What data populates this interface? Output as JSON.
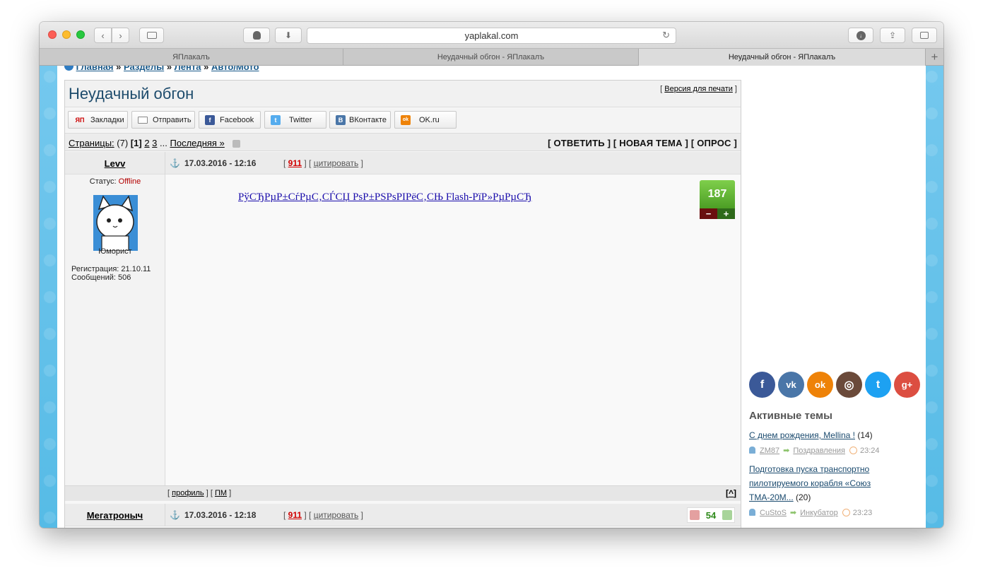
{
  "browser": {
    "url": "yaplakal.com",
    "tabs": [
      {
        "title": "ЯПлакалъ"
      },
      {
        "title": "Неудачный обгон - ЯПлакалъ"
      },
      {
        "title": "Неудачный обгон - ЯПлакалъ"
      }
    ],
    "new_tab": "+"
  },
  "breadcrumb": {
    "items": [
      "Главная",
      "Разделы",
      "Лента",
      "Авто/Мото"
    ],
    "sep": "»"
  },
  "topic": {
    "title": "Неудачный обгон",
    "print_link": "Версия для печати"
  },
  "share": [
    {
      "label": "Закладки",
      "icon": "ЯП",
      "color": "#cc0000"
    },
    {
      "label": "Отправить",
      "icon": "envelope-icon",
      "color": "#888888"
    },
    {
      "label": "Facebook",
      "icon": "f",
      "color": "#3b5998"
    },
    {
      "label": "Twitter",
      "icon": "t",
      "color": "#55acee"
    },
    {
      "label": "ВКонтакте",
      "icon": "В",
      "color": "#4a76a8"
    },
    {
      "label": "OK.ru",
      "icon": "ok",
      "color": "#ee8208"
    }
  ],
  "pages": {
    "label": "Страницы:",
    "count": "(7)",
    "current": "[1]",
    "p2": "2",
    "p3": "3",
    "ellipsis": "...",
    "last": "Последняя »"
  },
  "actions": {
    "reply": "ОТВЕТИТЬ",
    "new_topic": "НОВАЯ ТЕМА",
    "poll": "ОПРОС"
  },
  "posts": [
    {
      "author": "Levv",
      "datetime": "17.03.2016 - 12:16",
      "num": "911",
      "quote": "цитировать",
      "status_label": "Статус:",
      "status": "Offline",
      "rank": "Юморист",
      "reg": "Регистрация: 21.10.11",
      "msgs": "Сообщений: 506",
      "text": "РўСЂРµР±СѓРµС‚СЃСЏ РѕР±РЅРѕРІРёС‚СЊ Flash-РїР»РµРµСЂ",
      "rating": "187",
      "minus": "−",
      "plus": "+",
      "profile": "профиль",
      "pm": "ПМ",
      "top": "^"
    },
    {
      "author": "Мегатроныч",
      "datetime": "17.03.2016 - 12:18",
      "num": "911",
      "quote": "цитировать",
      "rating": "54"
    }
  ],
  "sidebar": {
    "social": [
      {
        "name": "facebook-icon",
        "glyph": "f",
        "color": "#3b5998"
      },
      {
        "name": "vk-icon",
        "glyph": "vk",
        "color": "#4a76a8"
      },
      {
        "name": "ok-icon",
        "glyph": "ok",
        "color": "#ee8208"
      },
      {
        "name": "instagram-icon",
        "glyph": "◎",
        "color": "#6b4a3a"
      },
      {
        "name": "twitter-icon",
        "glyph": "t",
        "color": "#1da1f2"
      },
      {
        "name": "googleplus-icon",
        "glyph": "g+",
        "color": "#dc4e41"
      }
    ],
    "active_heading": "Активные темы",
    "topics": [
      {
        "title": "С днем рождения, Mellina !",
        "count": "(14)",
        "user": "ZM87",
        "section": "Поздравления",
        "time": "23:24"
      },
      {
        "title_l1": "Подготовка пуска транспортно",
        "title_l2": "пилотируемого корабля «Союз",
        "title_l3": "ТМА-20М...",
        "count": "(20)",
        "user": "CuStoS",
        "section": "Инкубатор",
        "time": "23:23"
      }
    ]
  }
}
